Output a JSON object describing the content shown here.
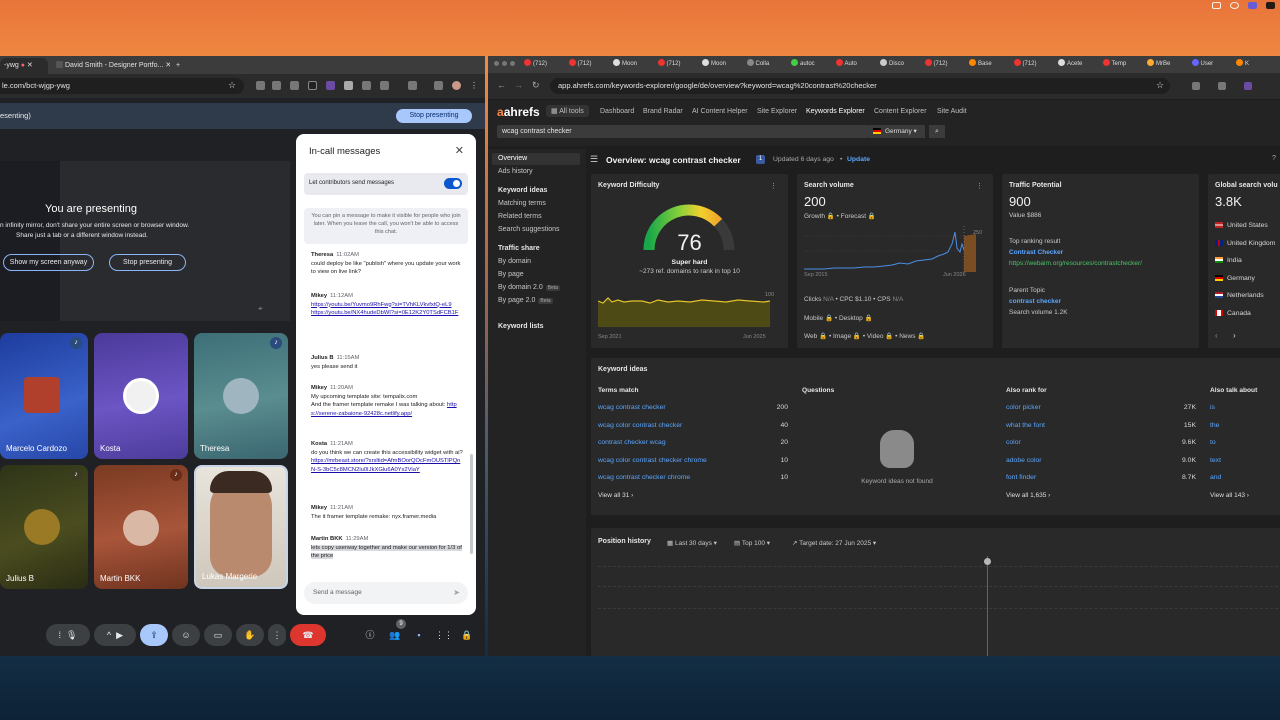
{
  "meet": {
    "tabs": [
      {
        "label": "-ywg"
      },
      {
        "label": "David Smith - Designer Portfo..."
      }
    ],
    "url": "le.com/bct-wjgp-ywg",
    "presenting_label": "esenting)",
    "stop_presenting_top": "Stop presenting",
    "stage": {
      "title": "You are presenting",
      "warning_line1": "n infinity mirror, don't share your entire screen or browser window.",
      "warning_line2": "Share just a tab or a different window instead.",
      "show_anyway": "Show my screen anyway",
      "stop_presenting": "Stop presenting"
    },
    "participants": [
      {
        "name": "Marcelo Cardozo"
      },
      {
        "name": "Kosta"
      },
      {
        "name": "Theresa"
      },
      {
        "name": "Julius B"
      },
      {
        "name": "Martin BKK"
      },
      {
        "name": "Lukas Margerie"
      }
    ],
    "people_count": "9",
    "chat": {
      "title": "In-call messages",
      "toggle_label": "Let contributors send messages",
      "pin_note": "You can pin a message to make it visible for people who join later. When you leave the call, you won't be able to access this chat.",
      "send_placeholder": "Send a message",
      "messages": [
        {
          "author": "Theresa",
          "time": "11:02AM",
          "text": "could deploy be like \"publish\" where you update your work to view on live link?"
        },
        {
          "author": "Mikey",
          "time": "11:12AM",
          "link1": "https://youtu.be/Yuvmo9RhFwg?si=TVhKLVkvfxtQ-eL9",
          "link2": "https://youtu.be/NX4hudeDbWI?si=0E12K2Y0TSdFCB1F"
        },
        {
          "author": "Julius B",
          "time": "11:15AM",
          "text": "yes please send it"
        },
        {
          "author": "Mikey",
          "time": "11:20AM",
          "text1": "My upcoming template site: tempalix.com",
          "text2": "And the framer template remake I was talking about:",
          "link": "https://serene-zabaione-92428c.netlify.app/"
        },
        {
          "author": "Kosta",
          "time": "11:21AM",
          "text": "do you think we can create this accessibility widget with ai?",
          "link": "https://mrbeast.store/?srsltid=AfmBOorQOcFmOUSTlPQnN-S-3bC5c8MCN2lu0IJkXGlu6A0Yx2ViaY"
        },
        {
          "author": "Mikey",
          "time": "11:21AM",
          "text": "The it framer template remake: nyx.framer.media"
        },
        {
          "author": "Martin BKK",
          "time": "11:29AM",
          "text": "lets copy userway together and make our version for 1/3 of the price"
        }
      ]
    }
  },
  "ahrefs": {
    "tabs": [
      "(712)",
      "(712)",
      "Moon",
      "(712)",
      "Moon",
      "Colla",
      "autoc",
      "Auto",
      "Disco",
      "(712)",
      "Base",
      "(712)",
      "Acete",
      "Temp",
      "MrBe",
      "User",
      "K"
    ],
    "url": "app.ahrefs.com/keywords-explorer/google/de/overview?keyword=wcag%20contrast%20checker",
    "logo": "ahrefs",
    "nav": [
      "All tools",
      "Dashboard",
      "Brand Radar",
      "AI Content Helper",
      "Site Explorer",
      "Keywords Explorer",
      "Content Explorer",
      "Site Audit"
    ],
    "search_value": "wcag contrast checker",
    "country": "Germany",
    "sidebar": {
      "top": [
        "Overview",
        "Ads history"
      ],
      "keyword_ideas_head": "Keyword ideas",
      "keyword_ideas": [
        "Matching terms",
        "Related terms",
        "Search suggestions"
      ],
      "traffic_head": "Traffic share",
      "traffic": [
        "By domain",
        "By page",
        "By domain 2.0",
        "By page 2.0"
      ],
      "beta": "Beta",
      "lists_head": "Keyword lists"
    },
    "overview_title": "Overview: wcag contrast checker",
    "overview_badge": "1",
    "updated": "Updated 6 days ago",
    "update_link": "Update",
    "kd": {
      "title": "Keyword Difficulty",
      "value": "76",
      "label": "Super hard",
      "sub": "~273 ref. domains to rank in top 10",
      "score": 76,
      "max": 100,
      "axis_left": "Sep 2021",
      "axis_right": "Jun 2025",
      "axis_top": "100"
    },
    "sv": {
      "title": "Search volume",
      "value": "200",
      "growth": "Growth",
      "forecast": "Forecast",
      "axis_left": "Sep 2015",
      "axis_right": "Jun 2026",
      "axis_top": "250",
      "clicks": "Clicks",
      "clicks_val": "N/A",
      "cpc": "CPC",
      "cpc_val": "$1.10",
      "cps": "CPS",
      "cps_val": "N/A",
      "mobile": "Mobile",
      "desktop": "Desktop",
      "web": "Web",
      "image": "Image",
      "video": "Video",
      "news": "News"
    },
    "tp": {
      "title": "Traffic Potential",
      "value": "900",
      "value_line": "Value $886",
      "top_result_label": "Top ranking result",
      "top_result_title": "Contrast Checker",
      "top_result_url": "https://webaim.org/resources/contrastchecker/",
      "parent_label": "Parent Topic",
      "parent_value": "contrast checker",
      "parent_volume": "Search volume 1.2K"
    },
    "gsv": {
      "title": "Global search volu",
      "value": "3.8K",
      "countries": [
        "United States",
        "United Kingdom",
        "India",
        "Germany",
        "Netherlands",
        "Canada"
      ]
    },
    "keyword_ideas": {
      "title": "Keyword ideas",
      "terms_match": "Terms match",
      "questions": "Questions",
      "also_rank": "Also rank for",
      "also_talk": "Also talk about",
      "terms": [
        {
          "k": "wcag contrast checker",
          "v": "200"
        },
        {
          "k": "wcag color contrast checker",
          "v": "40"
        },
        {
          "k": "contrast checker wcag",
          "v": "20"
        },
        {
          "k": "wcag color contrast checker chrome",
          "v": "10"
        },
        {
          "k": "wcag contrast checker chrome",
          "v": "10"
        }
      ],
      "rank": [
        {
          "k": "color picker",
          "v": "27K"
        },
        {
          "k": "what the font",
          "v": "15K"
        },
        {
          "k": "color",
          "v": "9.6K"
        },
        {
          "k": "adobe color",
          "v": "9.0K"
        },
        {
          "k": "font finder",
          "v": "8.7K"
        }
      ],
      "talk": [
        "is",
        "the",
        "to",
        "text",
        "and"
      ],
      "view_terms": "View all 31",
      "view_rank": "View all 1,635",
      "view_talk": "View all 143",
      "empty": "Keyword ideas not found"
    },
    "position_history": {
      "title": "Position history",
      "range": "Last 30 days",
      "top": "Top 100",
      "target": "Target date: 27 Jun 2025"
    }
  }
}
